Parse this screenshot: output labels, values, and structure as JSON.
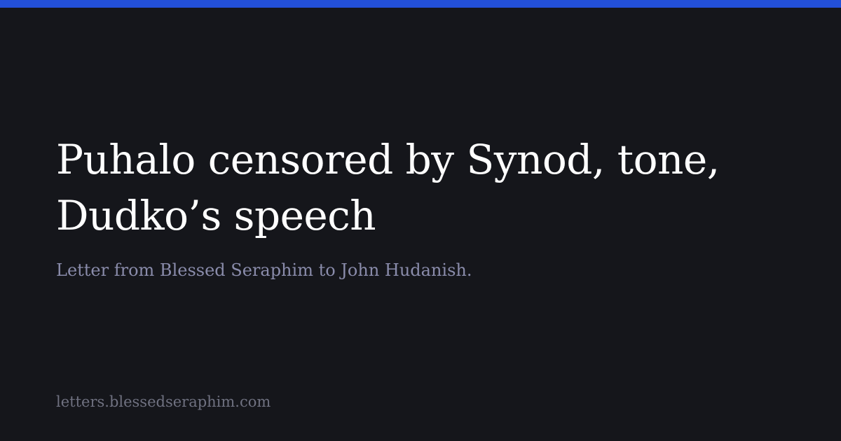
{
  "card": {
    "title": "Puhalo censored by Synod, tone, Dudko’s speech",
    "subtitle": "Letter from Blessed Seraphim to John Hudanish.",
    "site_url": "letters.blessedseraphim.com"
  },
  "colors": {
    "background": "#15161b",
    "accent_bar": "#2350d8",
    "title": "#ffffff",
    "subtitle": "#8a8cab",
    "footer": "#6f7180"
  }
}
